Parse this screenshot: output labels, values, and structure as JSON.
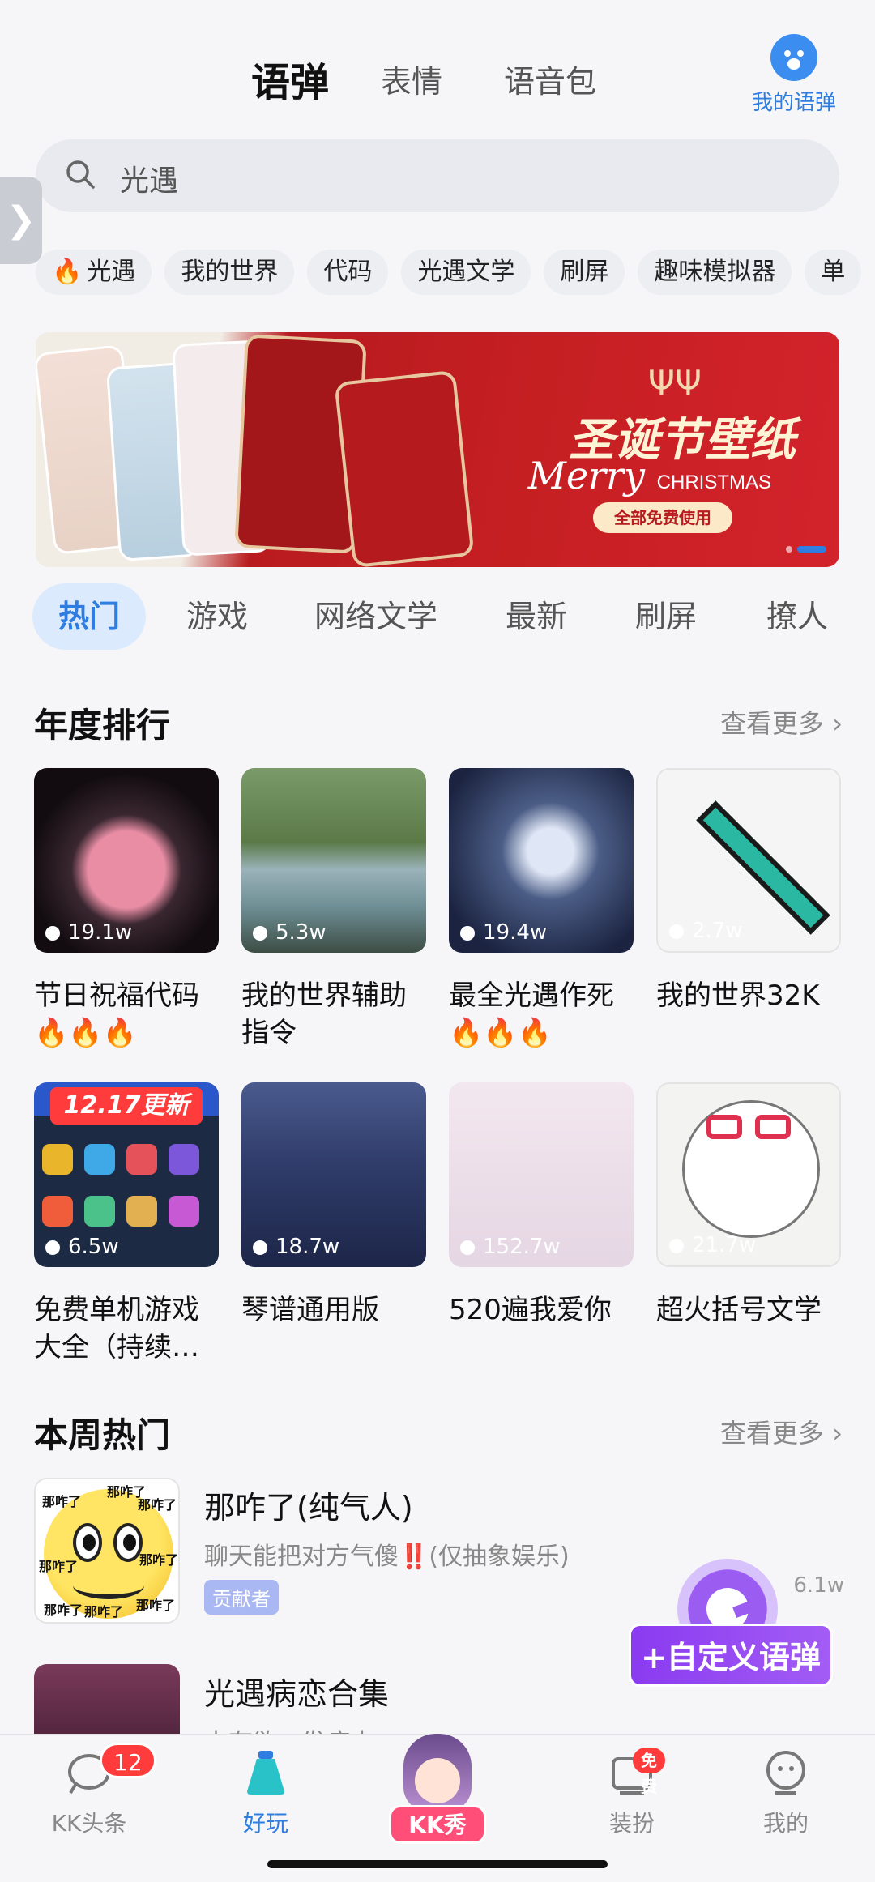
{
  "top_tabs": [
    "语弹",
    "表情",
    "语音包"
  ],
  "my_yudan_label": "我的语弹",
  "search": {
    "value": "光遇"
  },
  "chips": [
    {
      "label": "光遇",
      "hot": true
    },
    {
      "label": "我的世界"
    },
    {
      "label": "代码"
    },
    {
      "label": "光遇文学"
    },
    {
      "label": "刷屏"
    },
    {
      "label": "趣味模拟器"
    },
    {
      "label": "单"
    }
  ],
  "banner": {
    "title": "圣诞节壁纸",
    "subtitle": "Merry",
    "subtitle_small": "CHRISTMAS",
    "button": "全部免费使用"
  },
  "category_tabs": [
    "热门",
    "游戏",
    "网络文学",
    "最新",
    "刷屏",
    "撩人"
  ],
  "annual": {
    "title": "年度排行",
    "more": "查看更多",
    "items": [
      {
        "name": "节日祝福代码🔥🔥🔥",
        "count": "19.1w"
      },
      {
        "name": "我的世界辅助指令",
        "count": "5.3w"
      },
      {
        "name": "最全光遇作死🔥🔥🔥",
        "count": "19.4w"
      },
      {
        "name": "我的世界32K",
        "count": "2.7w"
      },
      {
        "name": "免费单机游戏大全（持续…",
        "count": "6.5w",
        "thumb_text": "12.17更新"
      },
      {
        "name": "琴谱通用版",
        "count": "18.7w"
      },
      {
        "name": "520遍我爱你",
        "count": "152.7w"
      },
      {
        "name": "超火括号文学",
        "count": "21.7w"
      }
    ]
  },
  "weekly": {
    "title": "本周热门",
    "more": "查看更多",
    "items": [
      {
        "title": "那咋了(纯气人)",
        "desc": "聊天能把对方气傻‼️(仅抽象娱乐)",
        "badge": "贡献者",
        "count": "6.1w",
        "thumb_text": "那咋了"
      },
      {
        "title": "光遇病恋合集",
        "desc": "占有欲，发病中"
      }
    ]
  },
  "float_button": "+自定义语弹",
  "bottom_nav": [
    {
      "label": "KK头条",
      "badge": "12"
    },
    {
      "label": "好玩",
      "active": true
    },
    {
      "label": "KK秀"
    },
    {
      "label": "装扮",
      "badge": "免费"
    },
    {
      "label": "我的"
    }
  ],
  "colors": {
    "accent": "#2f7de0",
    "float": "#9b5cf2",
    "badge": "#ff3b3b"
  }
}
